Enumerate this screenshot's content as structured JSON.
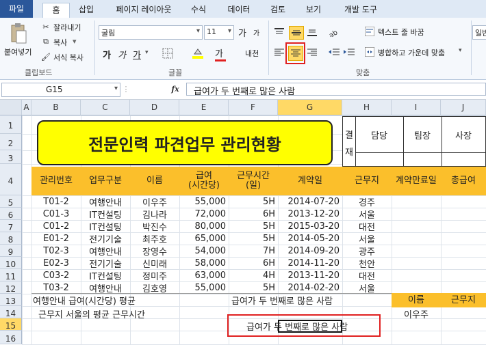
{
  "tabs": [
    "파일",
    "홈",
    "삽입",
    "페이지 레이아웃",
    "수식",
    "데이터",
    "검토",
    "보기",
    "개발 도구"
  ],
  "clipboard": {
    "paste": "붙여넣기",
    "cut": "잘라내기",
    "copy": "복사",
    "format_painter": "서식 복사",
    "group": "클립보드"
  },
  "font": {
    "name": "굴림",
    "size": "11",
    "grow": "가",
    "shrink": "가",
    "bold": "가",
    "italic": "가",
    "underline": "가",
    "group": "글꼴",
    "color_a": "가",
    "phonetic": "내천"
  },
  "align": {
    "wrap": "텍스트 줄 바꿈",
    "merge": "병합하고 가운데 맞춤",
    "group": "맞춤"
  },
  "number": {
    "format": "일반"
  },
  "formula_bar": {
    "name_box": "G15",
    "fx": "fx",
    "content": "급여가 두 번째로 많은 사람"
  },
  "columns": [
    "A",
    "B",
    "C",
    "D",
    "E",
    "F",
    "G",
    "H",
    "I",
    "J"
  ],
  "rows": [
    "1",
    "2",
    "3",
    "4",
    "5",
    "6",
    "7",
    "8",
    "9",
    "10",
    "11",
    "12",
    "13",
    "14",
    "15",
    "16"
  ],
  "title": "전문인력 파견업무 관리현황",
  "approval": {
    "label1": "결",
    "label2": "재",
    "c1": "담당",
    "c2": "팀장",
    "c3": "사장"
  },
  "headers": [
    "관리번호",
    "업무구분",
    "이름",
    "급여\n(시간당)",
    "근무시간\n(일)",
    "계약일",
    "근무지",
    "계약만료일",
    "총급여"
  ],
  "data": [
    [
      "T01-2",
      "여행안내",
      "이우주",
      "55,000",
      "5H",
      "2014-07-20",
      "경주"
    ],
    [
      "C01-3",
      "IT컨설팅",
      "김나라",
      "72,000",
      "6H",
      "2013-12-20",
      "서울"
    ],
    [
      "C01-2",
      "IT컨설팅",
      "박진수",
      "80,000",
      "5H",
      "2015-03-20",
      "대전"
    ],
    [
      "E01-2",
      "전기기술",
      "최주호",
      "65,000",
      "5H",
      "2014-05-20",
      "서울"
    ],
    [
      "T02-3",
      "여행안내",
      "장영수",
      "54,000",
      "7H",
      "2014-09-20",
      "광주"
    ],
    [
      "E02-3",
      "전기기술",
      "신미래",
      "58,000",
      "6H",
      "2014-11-20",
      "천안"
    ],
    [
      "C03-2",
      "IT컨설팅",
      "정미주",
      "63,000",
      "4H",
      "2013-11-20",
      "대전"
    ],
    [
      "T03-2",
      "여행안내",
      "김호영",
      "55,000",
      "5H",
      "2014-02-20",
      "서울"
    ]
  ],
  "r13": {
    "b": "여행안내 급여(시간당) 평균",
    "f": "급여가 두 번째로 많은 사람",
    "i": "이름",
    "j": "근무지"
  },
  "r14": {
    "b": "근무지 서울의 평균 근무시간",
    "i": "이우주"
  },
  "r15": {
    "g": "급여가 두 번째로 많은 사람"
  },
  "colors": {
    "header_fill": "#fbbf2b",
    "title_fill": "#ffff00",
    "highlight": "#e02020"
  }
}
